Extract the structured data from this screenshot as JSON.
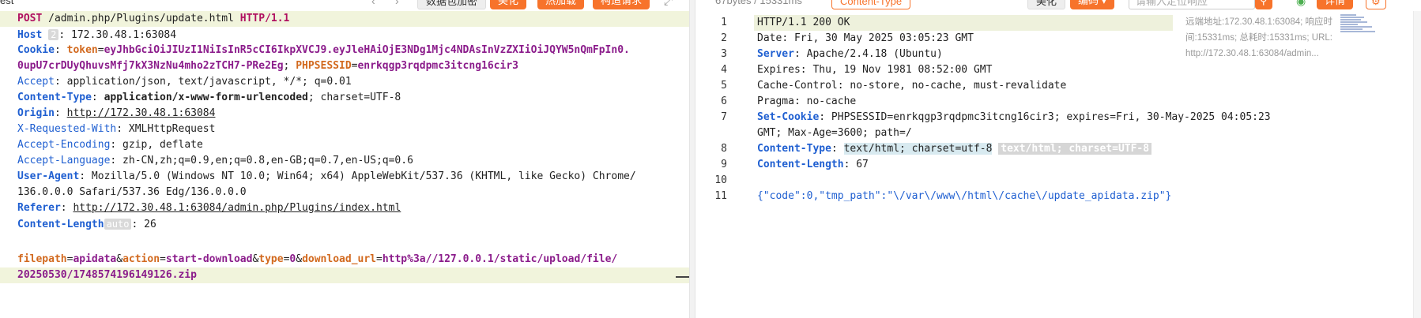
{
  "toolbar": {
    "left_tab_fragment": "est",
    "decode_label": "数据包加密",
    "beautify_label": "美化",
    "hot_load_label": "热加载",
    "build_request_label": "构造请求",
    "resp_size": "67bytes / 15331ms",
    "content_type_label": "Content-Type",
    "right_beautify_label": "美化",
    "encoding_label": "编码",
    "locate_placeholder": "请输入定位响应",
    "detail_label": "详情"
  },
  "request": {
    "request_line": {
      "method": "POST",
      "path": " /admin.php/Plugins/update.html ",
      "version": "HTTP/1.1"
    },
    "host": {
      "key": "Host",
      "badge": "2",
      "value": " 172.30.48.1:63084"
    },
    "cookie": {
      "key": "Cookie",
      "token_key": "token",
      "token_value_1": "eyJhbGciOiJIUzI1NiIsInR5cCI6IkpXVCJ9.eyJleHAiOjE3NDg1Mjc4NDAsInVzZXIiOiJQYW5nQmFpIn0.",
      "token_value_2": "0upU7crDUyQhuvsMfj7kX3NzNu4mho2zTCH7-PRe2Eg",
      "sid_key": "PHPSESSID",
      "sid_value": "enrkqgp3rqdpmc3itcng16cir3"
    },
    "accept": {
      "key": "Accept",
      "value": " application/json, text/javascript, */*; q=0.01"
    },
    "content_type": {
      "key": "Content-Type",
      "value1": "application/x-www-form-urlencoded",
      "value2": "; charset=UTF-8"
    },
    "origin": {
      "key": "Origin",
      "value": "http://172.30.48.1:63084"
    },
    "x_requested_with": {
      "key": "X-Requested-With",
      "value": " XMLHttpRequest"
    },
    "accept_encoding": {
      "key": "Accept-Encoding",
      "value": " gzip, deflate"
    },
    "accept_language": {
      "key": "Accept-Language",
      "value": " zh-CN,zh;q=0.9,en;q=0.8,en-GB;q=0.7,en-US;q=0.6"
    },
    "user_agent": {
      "key": "User-Agent",
      "value_1": " Mozilla/5.0 (Windows NT 10.0; Win64; x64) AppleWebKit/537.36 (KHTML, like Gecko) Chrome/",
      "value_2": "136.0.0.0 Safari/537.36 Edg/136.0.0.0"
    },
    "referer": {
      "key": "Referer",
      "value": "http://172.30.48.1:63084/admin.php/Plugins/index.html"
    },
    "content_length": {
      "key": "Content-Length",
      "badge": "auto",
      "value": " 26"
    },
    "body": {
      "k1": "filepath",
      "v1": "apidata",
      "k2": "action",
      "v2": "start-download",
      "k3": "type",
      "v3": "0",
      "k4": "download_url",
      "v4": "http%3a//127.0.0.1/static/upload/file/",
      "v4_cont": "20250530/1748574196149126.zip"
    }
  },
  "response": {
    "line_numbers": [
      "1",
      "2",
      "3",
      "4",
      "5",
      "6",
      "7",
      "8",
      "9",
      "10",
      "11"
    ],
    "status": "HTTP/1.1 200 OK",
    "date": {
      "key": "Date",
      "value": " Fri, 30 May 2025 03:05:23 GMT"
    },
    "server": {
      "key": "Server",
      "value": " Apache/2.4.18 (Ubuntu)"
    },
    "expires": {
      "key": "Expires",
      "value": " Thu, 19 Nov 1981 08:52:00 GMT"
    },
    "cache_control": {
      "key": "Cache-Control",
      "value": " no-store, no-cache, must-revalidate"
    },
    "pragma": {
      "key": "Pragma",
      "value": " no-cache"
    },
    "set_cookie": {
      "key": "Set-Cookie",
      "value_1": " PHPSESSID=enrkqgp3rqdpmc3itcng16cir3; expires=Fri, 30-May-2025 04:05:23",
      "value_2": "GMT; Max-Age=3600; path=/"
    },
    "content_type": {
      "key": "Content-Type",
      "value": "text/html; charset=utf-8",
      "chip": "text/html; charset=UTF-8"
    },
    "content_length": {
      "key": "Content-Length",
      "value": " 67"
    },
    "body": "{\"code\":0,\"tmp_path\":\"\\/var\\/www\\/html\\/cache\\/update_apidata.zip\"}"
  },
  "info": {
    "remote": "远端地址:172.30.48.1:63084; 响应时间:15331ms; 总耗时:15331ms; URL:http://172.30.48.1:63084/admin..."
  }
}
